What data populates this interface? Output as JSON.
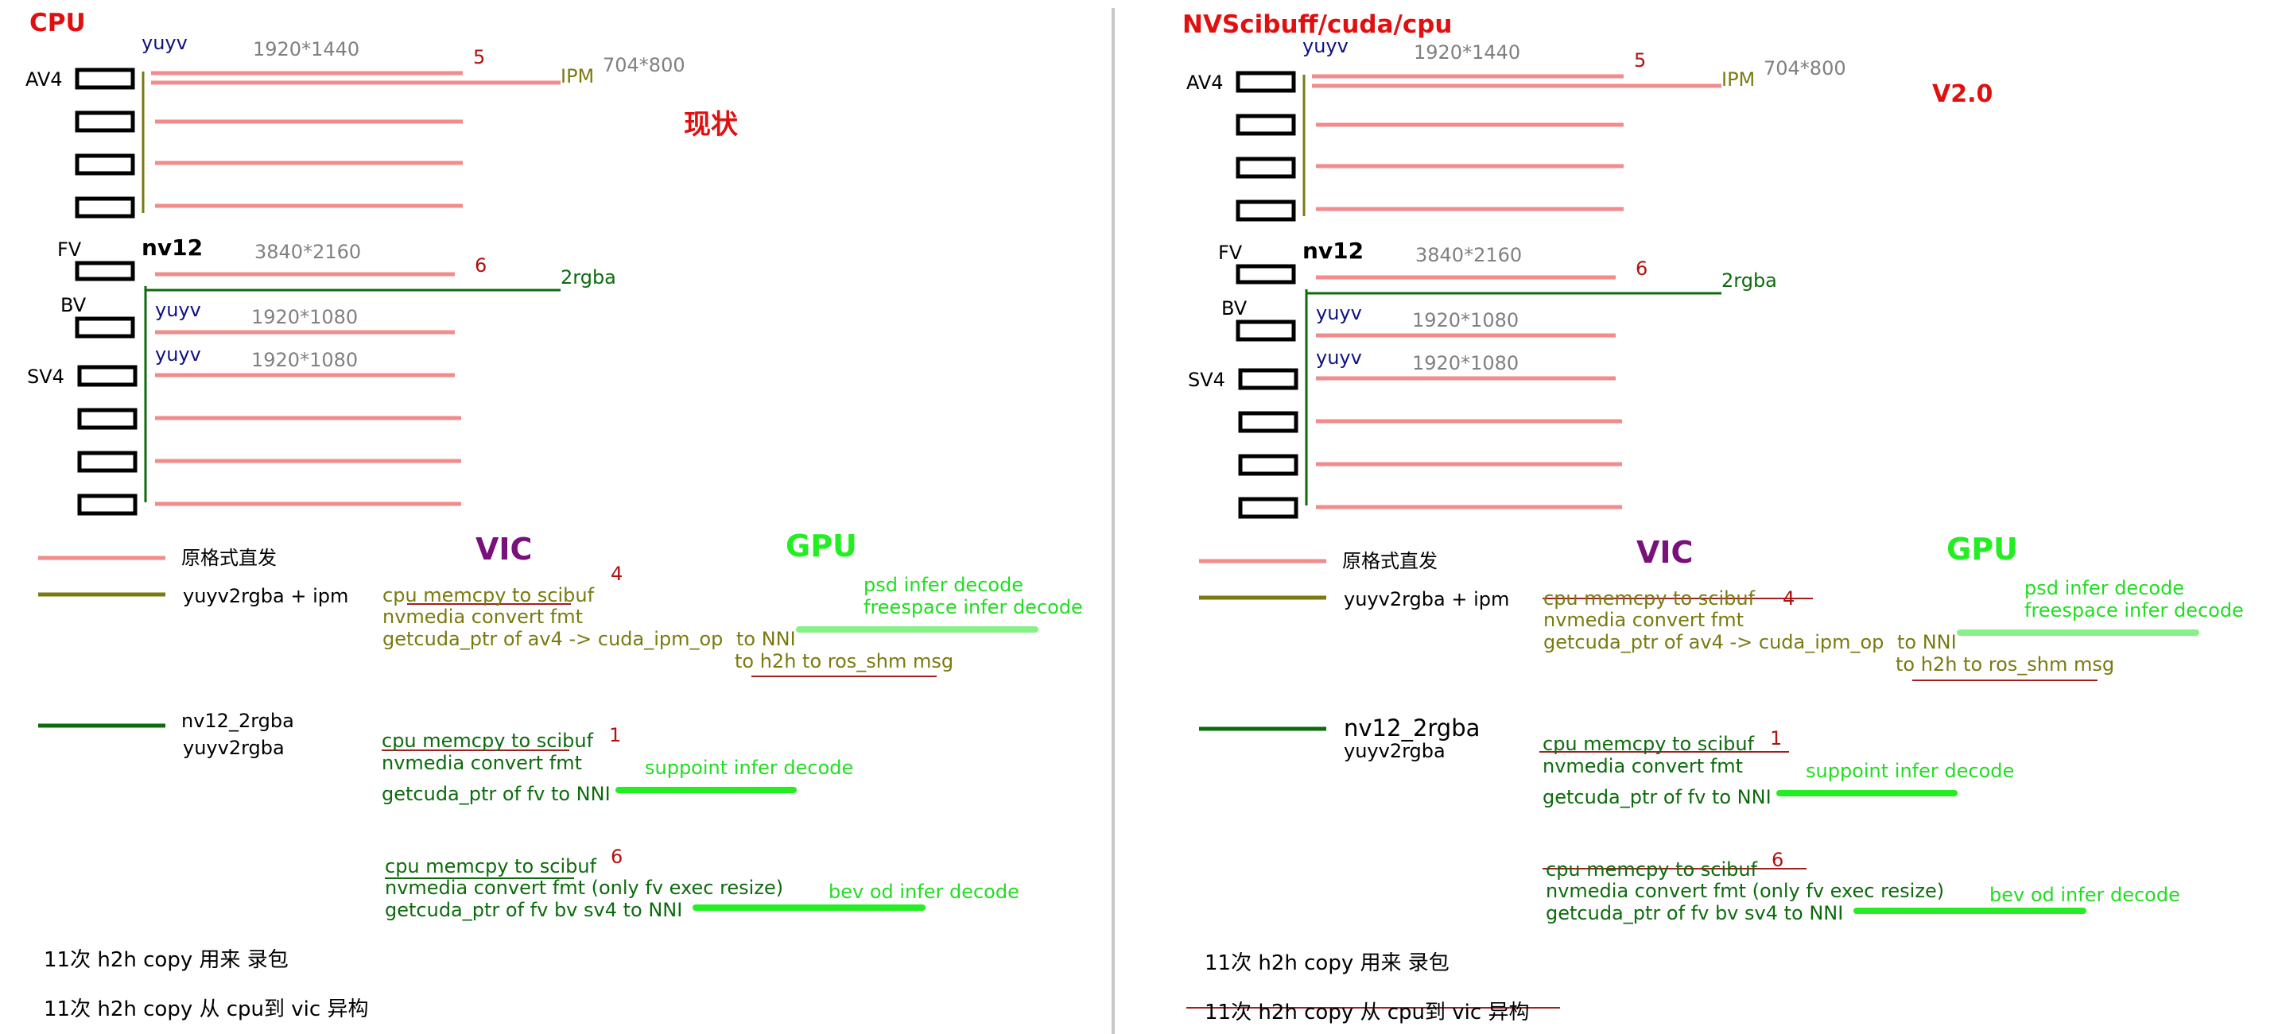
{
  "colors": {
    "raw_line": "#f28b8b",
    "olive_line": "#7a7a10",
    "dark_green_line": "#0d6b0d",
    "light_green_line": "#22ee22",
    "pale_green_line": "#88f088",
    "strike_red": "#a02020",
    "title_red": "#e01010",
    "vic_purple": "#7a107a",
    "gpu_green": "#22ee22"
  },
  "left": {
    "title": "CPU",
    "status": "现状",
    "cam_labels": {
      "av4": "AV4",
      "fv": "FV",
      "bv": "BV",
      "sv4": "SV4"
    },
    "fmt": {
      "av4": "yuyv",
      "fv": "nv12",
      "bv": "yuyv",
      "sv4": "yuyv"
    },
    "res": {
      "av4": "1920*1440",
      "ipm": "704*800",
      "fv": "3840*2160",
      "bv": "1920*1080",
      "sv4": "1920*1080"
    },
    "nums": {
      "av4": "5",
      "fv": "6"
    },
    "ipm_label": "IPM",
    "rgba_label": "2rgba",
    "legend": {
      "raw": "原格式直发",
      "olive": "yuyv2rgba + ipm",
      "green1": "nv12_2rgba",
      "green2": "yuyv2rgba"
    },
    "vic": "VIC",
    "gpu": "GPU",
    "block1": {
      "l1": "cpu memcpy to scibuf",
      "n": "4",
      "l2": "nvmedia convert fmt",
      "l3": "getcuda_ptr of av4 -> cuda_ipm_op",
      "to_nni": "to NNI",
      "h2h": "to h2h to ros_shm msg",
      "g1": "psd infer decode",
      "g2": "freespace infer decode"
    },
    "block2": {
      "l1": "cpu memcpy to scibuf",
      "n": "1",
      "l2": "nvmedia convert fmt",
      "l3": "getcuda_ptr of fv to NNI",
      "g": "suppoint infer decode"
    },
    "block3": {
      "l1": "cpu memcpy to scibuf",
      "n": "6",
      "l2": "nvmedia convert fmt (only fv exec resize)",
      "l3": "getcuda_ptr of fv bv sv4 to NNI",
      "g": "bev  od infer decode"
    },
    "note1": "11次 h2h copy 用来 录包",
    "note2": "11次 h2h copy 从 cpu到 vic 异构"
  },
  "right": {
    "title": "NVScibuff/cuda/cpu",
    "status": "V2.0",
    "cam_labels": {
      "av4": "AV4",
      "fv": "FV",
      "bv": "BV",
      "sv4": "SV4"
    },
    "fmt": {
      "av4": "yuyv",
      "fv": "nv12",
      "bv": "yuyv",
      "sv4": "yuyv"
    },
    "res": {
      "av4": "1920*1440",
      "ipm": "704*800",
      "fv": "3840*2160",
      "bv": "1920*1080",
      "sv4": "1920*1080"
    },
    "nums": {
      "av4": "5",
      "fv": "6"
    },
    "ipm_label": "IPM",
    "rgba_label": "2rgba",
    "legend": {
      "raw": "原格式直发",
      "olive": "yuyv2rgba + ipm",
      "green1": "nv12_2rgba",
      "green2": "yuyv2rgba"
    },
    "vic": "VIC",
    "gpu": "GPU",
    "block1": {
      "l1": "cpu memcpy to scibuf",
      "n": "4",
      "l2": "nvmedia convert fmt",
      "l3": "getcuda_ptr of av4 -> cuda_ipm_op",
      "to_nni": "to NNI",
      "h2h": "to h2h to ros_shm msg",
      "g1": "psd infer decode",
      "g2": "freespace infer decode"
    },
    "block2": {
      "l1": "cpu memcpy to scibuf",
      "n": "1",
      "l2": "nvmedia convert fmt",
      "l3": "getcuda_ptr of fv to NNI",
      "g": "suppoint infer decode"
    },
    "block3": {
      "l1": "cpu memcpy to scibuf",
      "n": "6",
      "l2": "nvmedia convert fmt (only fv exec resize)",
      "l3": "getcuda_ptr of fv bv sv4 to NNI",
      "g": "bev  od infer decode"
    },
    "note1": "11次 h2h copy 用来 录包",
    "note2": "11次 h2h copy 从 cpu到 vic 异构"
  }
}
